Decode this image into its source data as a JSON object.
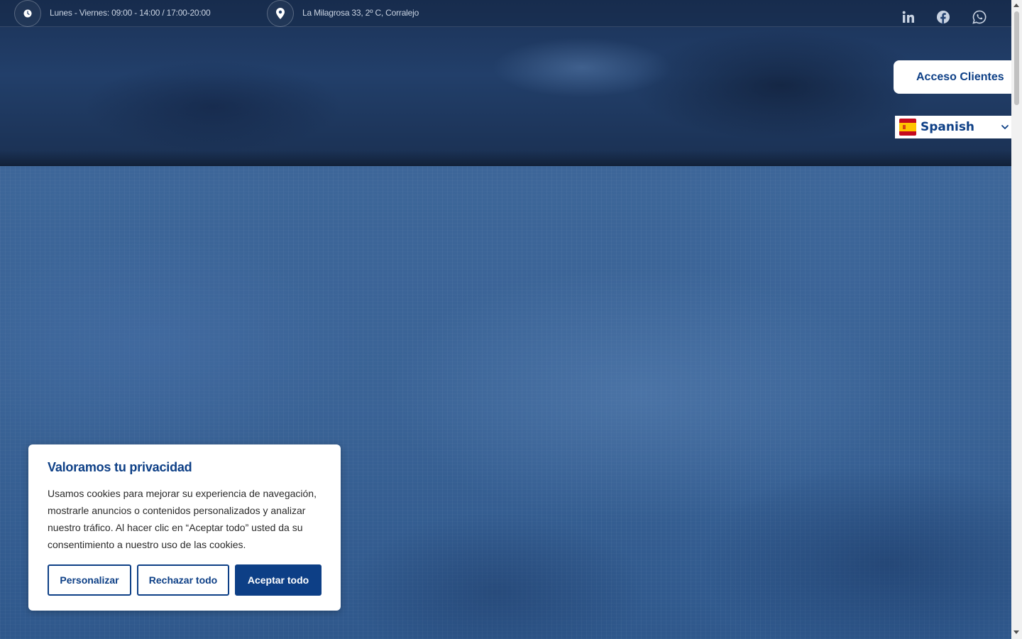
{
  "topbar": {
    "hours": {
      "icon": "clock-icon",
      "text": "Lunes - Viernes: 09:00 - 14:00 / 17:00-20:00"
    },
    "address": {
      "icon": "map-pin-icon",
      "text": "La Milagrosa 33, 2º C, Corralejo"
    },
    "social": [
      "linkedin-icon",
      "facebook-icon",
      "whatsapp-icon"
    ]
  },
  "header": {
    "access_button": "Acceso Clientes",
    "language": {
      "selected": "Spanish",
      "flag": "spain-flag-icon"
    }
  },
  "cookie_banner": {
    "title": "Valoramos tu privacidad",
    "body": "Usamos cookies para mejorar su experiencia de navegación, mostrarle anuncios o contenidos personalizados y analizar nuestro tráfico. Al hacer clic en “Aceptar todo” usted da su consentimiento a nuestro uso de las cookies.",
    "buttons": {
      "customize": "Personalizar",
      "reject": "Rechazar todo",
      "accept": "Aceptar todo"
    }
  },
  "colors": {
    "brand": "#0d3f86",
    "background": "#3a6396"
  }
}
